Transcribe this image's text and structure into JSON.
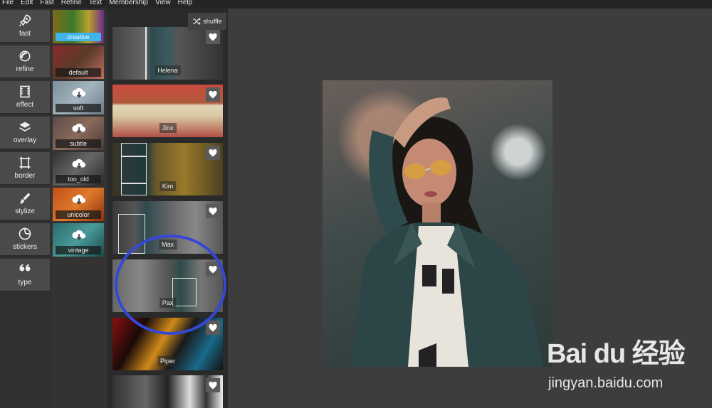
{
  "menu": [
    "File",
    "Edit",
    "Fast",
    "Refine",
    "Text",
    "Membership",
    "View",
    "Help"
  ],
  "tools": [
    {
      "label": "fast",
      "icon": "rocket-icon"
    },
    {
      "label": "refine",
      "icon": "refine-icon"
    },
    {
      "label": "effect",
      "icon": "film-icon"
    },
    {
      "label": "overlay",
      "icon": "layers-icon"
    },
    {
      "label": "border",
      "icon": "border-icon"
    },
    {
      "label": "stylize",
      "icon": "brush-icon"
    },
    {
      "label": "stickers",
      "icon": "sticker-icon"
    },
    {
      "label": "type",
      "icon": "quote-icon"
    }
  ],
  "categories": [
    {
      "label": "creative",
      "active": true
    },
    {
      "label": "default"
    },
    {
      "label": "soft"
    },
    {
      "label": "subtle"
    },
    {
      "label": "too_old"
    },
    {
      "label": "unicolor"
    },
    {
      "label": "vintage"
    }
  ],
  "shuffle_label": "shuffle",
  "filters": [
    "Helena",
    "Jinx",
    "Kim",
    "Max",
    "Pax",
    "Piper",
    ""
  ],
  "watermark": {
    "logo": "Bai du 经验",
    "url": "jingyan.baidu.com"
  },
  "colors": {
    "accent": "#3fb4e9",
    "highlight_circle": "#3448d8"
  }
}
